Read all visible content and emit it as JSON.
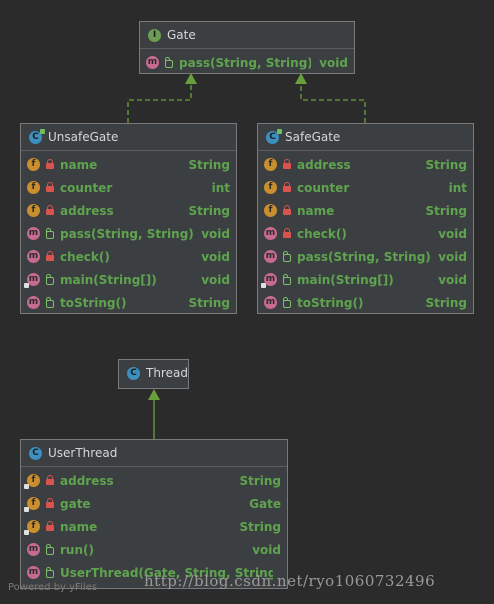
{
  "classes": {
    "gate": {
      "name": "Gate",
      "kind": "I",
      "members": [
        {
          "badge": "m",
          "vis": "public",
          "name": "pass(String, String)",
          "type": "void"
        }
      ]
    },
    "unsafe_gate": {
      "name": "UnsafeGate",
      "kind": "C",
      "members": [
        {
          "badge": "f",
          "vis": "private",
          "name": "name",
          "type": "String"
        },
        {
          "badge": "f",
          "vis": "private",
          "name": "counter",
          "type": "int"
        },
        {
          "badge": "f",
          "vis": "private",
          "name": "address",
          "type": "String"
        },
        {
          "badge": "m",
          "vis": "public",
          "name": "pass(String, String)",
          "type": "void"
        },
        {
          "badge": "m",
          "vis": "private",
          "name": "check()",
          "type": "void"
        },
        {
          "badge": "m",
          "vis": "public",
          "name": "main(String[])",
          "type": "void",
          "static": true
        },
        {
          "badge": "m",
          "vis": "public",
          "name": "toString()",
          "type": "String"
        }
      ]
    },
    "safe_gate": {
      "name": "SafeGate",
      "kind": "C",
      "members": [
        {
          "badge": "f",
          "vis": "private",
          "name": "address",
          "type": "String"
        },
        {
          "badge": "f",
          "vis": "private",
          "name": "counter",
          "type": "int"
        },
        {
          "badge": "f",
          "vis": "private",
          "name": "name",
          "type": "String"
        },
        {
          "badge": "m",
          "vis": "private",
          "name": "check()",
          "type": "void"
        },
        {
          "badge": "m",
          "vis": "public",
          "name": "pass(String, String)",
          "type": "void"
        },
        {
          "badge": "m",
          "vis": "public",
          "name": "main(String[])",
          "type": "void",
          "static": true
        },
        {
          "badge": "m",
          "vis": "public",
          "name": "toString()",
          "type": "String"
        }
      ]
    },
    "thread": {
      "name": "Thread",
      "kind": "C",
      "members": []
    },
    "user_thread": {
      "name": "UserThread",
      "kind": "C",
      "members": [
        {
          "badge": "f",
          "vis": "private",
          "name": "address",
          "type": "String",
          "static": true
        },
        {
          "badge": "f",
          "vis": "private",
          "name": "gate",
          "type": "Gate",
          "static": true
        },
        {
          "badge": "f",
          "vis": "private",
          "name": "name",
          "type": "String",
          "static": true
        },
        {
          "badge": "m",
          "vis": "public",
          "name": "run()",
          "type": "void"
        },
        {
          "badge": "m",
          "vis": "public",
          "name": "UserThread(Gate, String, String)",
          "type": ""
        }
      ]
    }
  },
  "watermark": "http://blog.csdn.net/ryo1060732496",
  "powered_by": "Powered by yFiles",
  "colors": {
    "background": "#2b2b2b",
    "box": "#3c3f41",
    "member_text": "#5fa34f",
    "arrow": "#6a9f3e",
    "field_badge": "#c98e2e",
    "method_badge": "#c66a8f"
  }
}
